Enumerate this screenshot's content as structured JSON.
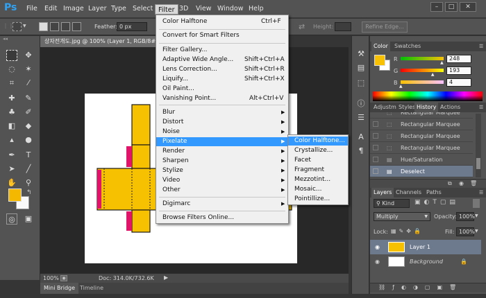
{
  "app": {
    "logo": "Ps"
  },
  "menubar": {
    "items": [
      "File",
      "Edit",
      "Image",
      "Layer",
      "Type",
      "Select",
      "Filter",
      "3D",
      "View",
      "Window",
      "Help"
    ]
  },
  "window_controls": {
    "minimize": "–",
    "maximize": "□",
    "close": "✕"
  },
  "options_bar": {
    "feather_label": "Feather:",
    "feather_value": "0 px",
    "height_label": "Height:",
    "refine_edge": "Refine Edge..."
  },
  "document": {
    "tab_title": "상자전개도.jpg @ 100% (Layer 1, RGB/8#)",
    "zoom": "100%",
    "doc_size": "Doc: 314.0K/732.6K"
  },
  "bottom_tabs": {
    "mini_bridge": "Mini Bridge",
    "timeline": "Timeline"
  },
  "filter_menu": {
    "items": [
      {
        "label": "Color Halftone",
        "shortcut": "Ctrl+F"
      },
      {
        "label": "Convert for Smart Filters",
        "shortcut": ""
      },
      {
        "label": "Filter Gallery...",
        "shortcut": ""
      },
      {
        "label": "Adaptive Wide Angle...",
        "shortcut": "Shift+Ctrl+A"
      },
      {
        "label": "Lens Correction...",
        "shortcut": "Shift+Ctrl+R"
      },
      {
        "label": "Liquify...",
        "shortcut": "Shift+Ctrl+X"
      },
      {
        "label": "Oil Paint...",
        "shortcut": ""
      },
      {
        "label": "Vanishing Point...",
        "shortcut": "Alt+Ctrl+V"
      },
      {
        "label": "Blur",
        "shortcut": ""
      },
      {
        "label": "Distort",
        "shortcut": ""
      },
      {
        "label": "Noise",
        "shortcut": ""
      },
      {
        "label": "Pixelate",
        "shortcut": ""
      },
      {
        "label": "Render",
        "shortcut": ""
      },
      {
        "label": "Sharpen",
        "shortcut": ""
      },
      {
        "label": "Stylize",
        "shortcut": ""
      },
      {
        "label": "Video",
        "shortcut": ""
      },
      {
        "label": "Other",
        "shortcut": ""
      },
      {
        "label": "Digimarc",
        "shortcut": ""
      },
      {
        "label": "Browse Filters Online...",
        "shortcut": ""
      }
    ]
  },
  "pixelate_submenu": {
    "items": [
      "Color Halftone...",
      "Crystallize...",
      "Facet",
      "Fragment",
      "Mezzotint...",
      "Mosaic...",
      "Pointillize..."
    ]
  },
  "color_panel": {
    "tabs": [
      "Color",
      "Swatches"
    ],
    "r_label": "R",
    "g_label": "G",
    "b_label": "B",
    "r": "248",
    "g": "193",
    "b": "4",
    "r_fraction": 0.97,
    "g_fraction": 0.757,
    "b_fraction": 0.016,
    "fg_color": "#f8c104"
  },
  "history_panel": {
    "tabs": [
      "Adjustm",
      "Styles",
      "History",
      "Actions"
    ],
    "items": [
      "Rectangular Marquee",
      "Rectangular Marquee",
      "Rectangular Marquee",
      "Rectangular Marquee",
      "Hue/Saturation",
      "Deselect"
    ]
  },
  "layers_panel": {
    "tabs": [
      "Layers",
      "Channels",
      "Paths"
    ],
    "kind": "Kind",
    "blend_mode": "Multiply",
    "opacity_label": "Opacity:",
    "opacity": "100%",
    "lock_label": "Lock:",
    "fill_label": "Fill:",
    "fill": "100%",
    "layers": [
      "Layer 1",
      "Background"
    ]
  },
  "colors": {
    "accent": "#3399ff",
    "box_yellow": "#f5c100",
    "box_magenta": "#e0156a"
  }
}
